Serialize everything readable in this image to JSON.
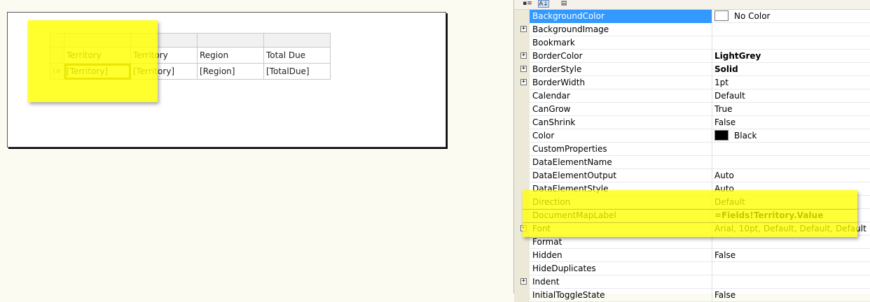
{
  "report": {
    "header_row": [
      "",
      "Territory",
      "Territory",
      "Region",
      "Total Due"
    ],
    "detail_row": [
      "",
      "[Territory]",
      "[Territory]",
      "[Region]",
      "[TotalDue]"
    ]
  },
  "toolbar": {
    "categorized_icon": "categorized-icon",
    "alphabetical_icon": "alphabetical-icon",
    "property_pages_icon": "property-pages-icon"
  },
  "properties": [
    {
      "name": "BackgroundColor",
      "value": "No Color",
      "swatch": "#ffffff",
      "expandable": false,
      "bold": false,
      "selected": true
    },
    {
      "name": "BackgroundImage",
      "value": "",
      "expandable": true,
      "bold": false
    },
    {
      "name": "Bookmark",
      "value": "",
      "expandable": false,
      "bold": false
    },
    {
      "name": "BorderColor",
      "value": "LightGrey",
      "expandable": true,
      "bold": true
    },
    {
      "name": "BorderStyle",
      "value": "Solid",
      "expandable": true,
      "bold": true
    },
    {
      "name": "BorderWidth",
      "value": "1pt",
      "expandable": true,
      "bold": false
    },
    {
      "name": "Calendar",
      "value": "Default",
      "expandable": false,
      "bold": false
    },
    {
      "name": "CanGrow",
      "value": "True",
      "expandable": false,
      "bold": false
    },
    {
      "name": "CanShrink",
      "value": "False",
      "expandable": false,
      "bold": false
    },
    {
      "name": "Color",
      "value": "Black",
      "swatch": "#000000",
      "expandable": false,
      "bold": false
    },
    {
      "name": "CustomProperties",
      "value": "",
      "expandable": false,
      "bold": false
    },
    {
      "name": "DataElementName",
      "value": "",
      "expandable": false,
      "bold": false
    },
    {
      "name": "DataElementOutput",
      "value": "Auto",
      "expandable": false,
      "bold": false
    },
    {
      "name": "DataElementStyle",
      "value": "Auto",
      "expandable": false,
      "bold": false
    },
    {
      "name": "Direction",
      "value": "Default",
      "expandable": false,
      "bold": false
    },
    {
      "name": "DocumentMapLabel",
      "value": "=Fields!Territory.Value",
      "expandable": false,
      "bold": true
    },
    {
      "name": "Font",
      "value": "Arial, 10pt, Default, Default, Default",
      "expandable": true,
      "bold": false
    },
    {
      "name": "Format",
      "value": "",
      "expandable": false,
      "bold": false
    },
    {
      "name": "Hidden",
      "value": "False",
      "expandable": false,
      "bold": false
    },
    {
      "name": "HideDuplicates",
      "value": "",
      "expandable": false,
      "bold": false
    },
    {
      "name": "Indent",
      "value": "",
      "expandable": true,
      "bold": false
    },
    {
      "name": "InitialToggleState",
      "value": "False",
      "expandable": false,
      "bold": false
    }
  ],
  "colors": {
    "selection": "#3399ff",
    "highlighter": "#ffff00",
    "canvas": "#fbfbf1"
  }
}
